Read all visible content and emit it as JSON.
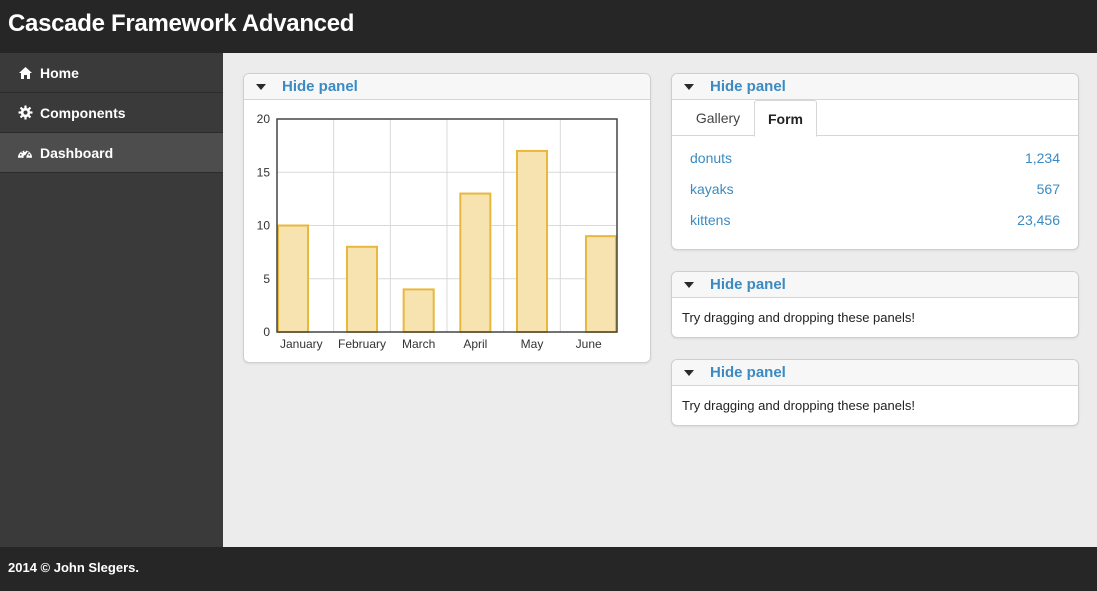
{
  "app": {
    "title": "Cascade Framework Advanced"
  },
  "sidebar": {
    "items": [
      {
        "label": "Home",
        "icon": "home-icon"
      },
      {
        "label": "Components",
        "icon": "gear-icon"
      },
      {
        "label": "Dashboard",
        "icon": "dashboard-icon",
        "active": true
      }
    ]
  },
  "panels": {
    "chart_panel": {
      "toggle_label": "Hide panel"
    },
    "tab_panel": {
      "toggle_label": "Hide panel",
      "tabs": [
        "Gallery",
        "Form"
      ],
      "active_tab": "Form",
      "rows": [
        {
          "name": "donuts",
          "value": "1,234"
        },
        {
          "name": "kayaks",
          "value": "567"
        },
        {
          "name": "kittens",
          "value": "23,456"
        }
      ]
    },
    "text_panel_1": {
      "toggle_label": "Hide panel",
      "text": "Try dragging and dropping these panels!"
    },
    "text_panel_2": {
      "toggle_label": "Hide panel",
      "text": "Try dragging and dropping these panels!"
    }
  },
  "footer": {
    "text": "2014 © John Slegers."
  },
  "chart_data": {
    "type": "bar",
    "categories": [
      "January",
      "February",
      "March",
      "April",
      "May",
      "June"
    ],
    "values": [
      10,
      8,
      4,
      13,
      17,
      9
    ],
    "ylim": [
      0,
      20
    ],
    "yticks": [
      0,
      5,
      10,
      15,
      20
    ],
    "grid": true,
    "bar_fill": "#f7e3b0",
    "bar_stroke": "#e8b83d"
  },
  "colors": {
    "link": "#3b8bc2",
    "topbar": "#262626",
    "sidebar": "#3a3a3a",
    "sidebar_active": "#4d4d4d",
    "background": "#ececec"
  }
}
